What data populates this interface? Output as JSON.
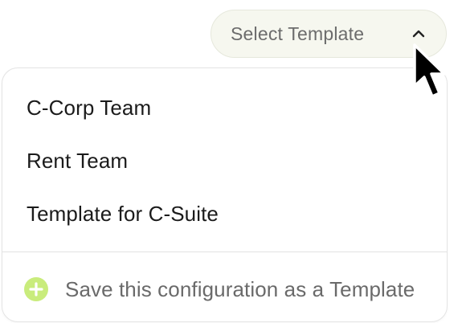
{
  "select": {
    "label": "Select Template",
    "icon": "chevron-up-icon",
    "background": "#f6f7ef"
  },
  "menu": {
    "items": [
      {
        "label": "C-Corp Team"
      },
      {
        "label": "Rent Team"
      },
      {
        "label": "Template for C-Suite"
      }
    ],
    "save_action": {
      "label": "Save this configuration as a Template",
      "icon": "plus-circle-icon",
      "icon_color": "#c9ec7c"
    }
  },
  "cursor": {
    "icon": "mouse-pointer-icon"
  }
}
